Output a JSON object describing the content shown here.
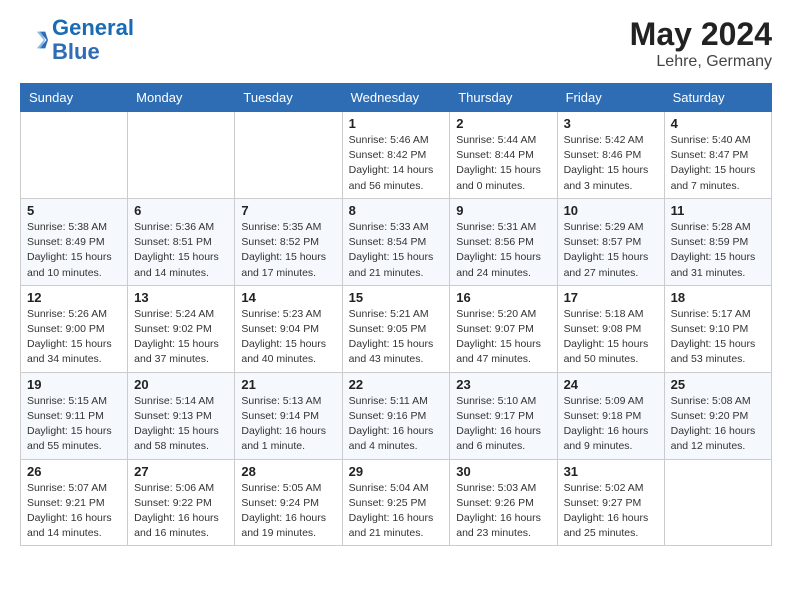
{
  "logo": {
    "part1": "General",
    "part2": "Blue"
  },
  "header": {
    "month": "May 2024",
    "location": "Lehre, Germany"
  },
  "days_of_week": [
    "Sunday",
    "Monday",
    "Tuesday",
    "Wednesday",
    "Thursday",
    "Friday",
    "Saturday"
  ],
  "weeks": [
    [
      {
        "num": "",
        "info": ""
      },
      {
        "num": "",
        "info": ""
      },
      {
        "num": "",
        "info": ""
      },
      {
        "num": "1",
        "info": "Sunrise: 5:46 AM\nSunset: 8:42 PM\nDaylight: 14 hours\nand 56 minutes."
      },
      {
        "num": "2",
        "info": "Sunrise: 5:44 AM\nSunset: 8:44 PM\nDaylight: 15 hours\nand 0 minutes."
      },
      {
        "num": "3",
        "info": "Sunrise: 5:42 AM\nSunset: 8:46 PM\nDaylight: 15 hours\nand 3 minutes."
      },
      {
        "num": "4",
        "info": "Sunrise: 5:40 AM\nSunset: 8:47 PM\nDaylight: 15 hours\nand 7 minutes."
      }
    ],
    [
      {
        "num": "5",
        "info": "Sunrise: 5:38 AM\nSunset: 8:49 PM\nDaylight: 15 hours\nand 10 minutes."
      },
      {
        "num": "6",
        "info": "Sunrise: 5:36 AM\nSunset: 8:51 PM\nDaylight: 15 hours\nand 14 minutes."
      },
      {
        "num": "7",
        "info": "Sunrise: 5:35 AM\nSunset: 8:52 PM\nDaylight: 15 hours\nand 17 minutes."
      },
      {
        "num": "8",
        "info": "Sunrise: 5:33 AM\nSunset: 8:54 PM\nDaylight: 15 hours\nand 21 minutes."
      },
      {
        "num": "9",
        "info": "Sunrise: 5:31 AM\nSunset: 8:56 PM\nDaylight: 15 hours\nand 24 minutes."
      },
      {
        "num": "10",
        "info": "Sunrise: 5:29 AM\nSunset: 8:57 PM\nDaylight: 15 hours\nand 27 minutes."
      },
      {
        "num": "11",
        "info": "Sunrise: 5:28 AM\nSunset: 8:59 PM\nDaylight: 15 hours\nand 31 minutes."
      }
    ],
    [
      {
        "num": "12",
        "info": "Sunrise: 5:26 AM\nSunset: 9:00 PM\nDaylight: 15 hours\nand 34 minutes."
      },
      {
        "num": "13",
        "info": "Sunrise: 5:24 AM\nSunset: 9:02 PM\nDaylight: 15 hours\nand 37 minutes."
      },
      {
        "num": "14",
        "info": "Sunrise: 5:23 AM\nSunset: 9:04 PM\nDaylight: 15 hours\nand 40 minutes."
      },
      {
        "num": "15",
        "info": "Sunrise: 5:21 AM\nSunset: 9:05 PM\nDaylight: 15 hours\nand 43 minutes."
      },
      {
        "num": "16",
        "info": "Sunrise: 5:20 AM\nSunset: 9:07 PM\nDaylight: 15 hours\nand 47 minutes."
      },
      {
        "num": "17",
        "info": "Sunrise: 5:18 AM\nSunset: 9:08 PM\nDaylight: 15 hours\nand 50 minutes."
      },
      {
        "num": "18",
        "info": "Sunrise: 5:17 AM\nSunset: 9:10 PM\nDaylight: 15 hours\nand 53 minutes."
      }
    ],
    [
      {
        "num": "19",
        "info": "Sunrise: 5:15 AM\nSunset: 9:11 PM\nDaylight: 15 hours\nand 55 minutes."
      },
      {
        "num": "20",
        "info": "Sunrise: 5:14 AM\nSunset: 9:13 PM\nDaylight: 15 hours\nand 58 minutes."
      },
      {
        "num": "21",
        "info": "Sunrise: 5:13 AM\nSunset: 9:14 PM\nDaylight: 16 hours\nand 1 minute."
      },
      {
        "num": "22",
        "info": "Sunrise: 5:11 AM\nSunset: 9:16 PM\nDaylight: 16 hours\nand 4 minutes."
      },
      {
        "num": "23",
        "info": "Sunrise: 5:10 AM\nSunset: 9:17 PM\nDaylight: 16 hours\nand 6 minutes."
      },
      {
        "num": "24",
        "info": "Sunrise: 5:09 AM\nSunset: 9:18 PM\nDaylight: 16 hours\nand 9 minutes."
      },
      {
        "num": "25",
        "info": "Sunrise: 5:08 AM\nSunset: 9:20 PM\nDaylight: 16 hours\nand 12 minutes."
      }
    ],
    [
      {
        "num": "26",
        "info": "Sunrise: 5:07 AM\nSunset: 9:21 PM\nDaylight: 16 hours\nand 14 minutes."
      },
      {
        "num": "27",
        "info": "Sunrise: 5:06 AM\nSunset: 9:22 PM\nDaylight: 16 hours\nand 16 minutes."
      },
      {
        "num": "28",
        "info": "Sunrise: 5:05 AM\nSunset: 9:24 PM\nDaylight: 16 hours\nand 19 minutes."
      },
      {
        "num": "29",
        "info": "Sunrise: 5:04 AM\nSunset: 9:25 PM\nDaylight: 16 hours\nand 21 minutes."
      },
      {
        "num": "30",
        "info": "Sunrise: 5:03 AM\nSunset: 9:26 PM\nDaylight: 16 hours\nand 23 minutes."
      },
      {
        "num": "31",
        "info": "Sunrise: 5:02 AM\nSunset: 9:27 PM\nDaylight: 16 hours\nand 25 minutes."
      },
      {
        "num": "",
        "info": ""
      }
    ]
  ]
}
